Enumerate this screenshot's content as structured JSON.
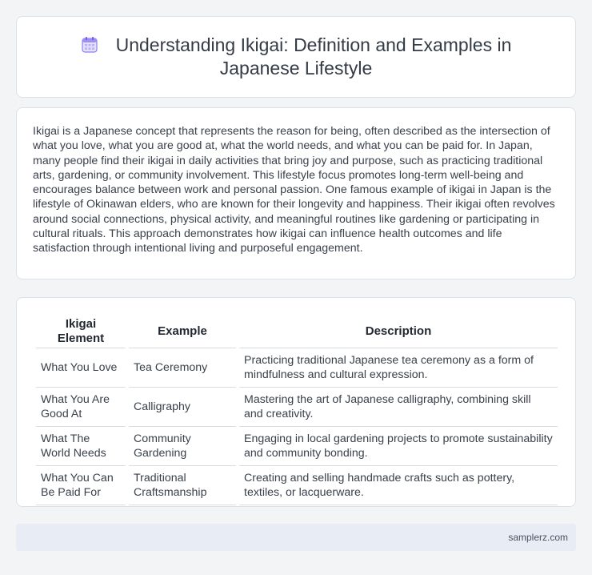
{
  "header": {
    "icon": "calendar-icon",
    "title": "Understanding Ikigai: Definition and Examples in Japanese Lifestyle"
  },
  "intro": {
    "text": "Ikigai is a Japanese concept that represents the reason for being, often described as the intersection of what you love, what you are good at, what the world needs, and what you can be paid for. In Japan, many people find their ikigai in daily activities that bring joy and purpose, such as practicing traditional arts, gardening, or community involvement. This lifestyle focus promotes long-term well-being and encourages balance between work and personal passion. One famous example of ikigai in Japan is the lifestyle of Okinawan elders, who are known for their longevity and happiness. Their ikigai often revolves around social connections, physical activity, and meaningful routines like gardening or participating in cultural rituals. This approach demonstrates how ikigai can influence health outcomes and life satisfaction through intentional living and purposeful engagement."
  },
  "table": {
    "headers": [
      "Ikigai Element",
      "Example",
      "Description"
    ],
    "rows": [
      [
        "What You Love",
        "Tea Ceremony",
        "Practicing traditional Japanese tea ceremony as a form of mindfulness and cultural expression."
      ],
      [
        "What You Are Good At",
        "Calligraphy",
        "Mastering the art of Japanese calligraphy, combining skill and creativity."
      ],
      [
        "What The World Needs",
        "Community Gardening",
        "Engaging in local gardening projects to promote sustainability and community bonding."
      ],
      [
        "What You Can Be Paid For",
        "Traditional Craftsmanship",
        "Creating and selling handmade crafts such as pottery, textiles, or lacquerware."
      ]
    ]
  },
  "footer": {
    "text": "samplerz.com"
  },
  "colors": {
    "page_bg": "#f3f4f6",
    "card_bg": "#ffffff",
    "footer_bg": "#e8ecf5",
    "icon_accent": "#7b6cf0"
  }
}
